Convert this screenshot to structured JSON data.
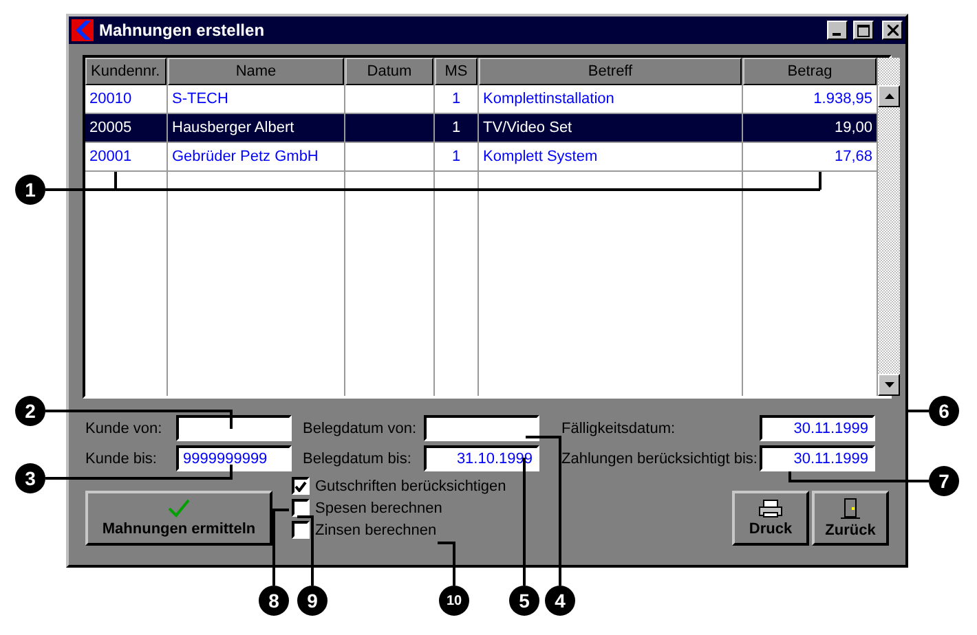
{
  "window": {
    "title": "Mahnungen erstellen"
  },
  "table": {
    "columns": [
      "Kundennr.",
      "Name",
      "Datum",
      "MS",
      "Betreff",
      "Betrag"
    ],
    "rows": [
      {
        "selected": false,
        "cells": [
          "20010",
          "S-TECH",
          "",
          "1",
          "Komplettinstallation",
          "1.938,95"
        ]
      },
      {
        "selected": true,
        "cells": [
          "20005",
          "Hausberger Albert",
          "",
          "1",
          "TV/Video Set",
          "19,00"
        ]
      },
      {
        "selected": false,
        "cells": [
          "20001",
          "Gebrüder Petz GmbH",
          "",
          "1",
          "Komplett System",
          "17,68"
        ]
      }
    ]
  },
  "fields": [
    {
      "label": "Kunde von:"
    },
    {
      "label": "Belegdatum von:"
    },
    {
      "label": "Fälligkeitsdatum:",
      "value": "30.11.1999"
    },
    {
      "label": "Kunde bis:",
      "value": "9999999999"
    },
    {
      "label": "Belegdatum bis:",
      "value": "31.10.1999"
    },
    {
      "label": "Zahlungen berücksichtigt bis:",
      "value": "30.11.1999"
    }
  ],
  "checkboxes": [
    {
      "label": "Gutschriften berücksichtigen",
      "checked": true
    },
    {
      "label": "Spesen berechnen",
      "checked": false
    },
    {
      "label": "Zinsen berechnen",
      "checked": false
    }
  ],
  "buttons": [
    {
      "label": "Mahnungen ermitteln",
      "kind": "check"
    },
    {
      "label": "Druck",
      "kind": "print"
    },
    {
      "label": "Zurück",
      "kind": "exit"
    }
  ],
  "callouts": [
    "1",
    "2",
    "3",
    "6",
    "7",
    "8",
    "9",
    "10",
    "5",
    "4"
  ]
}
